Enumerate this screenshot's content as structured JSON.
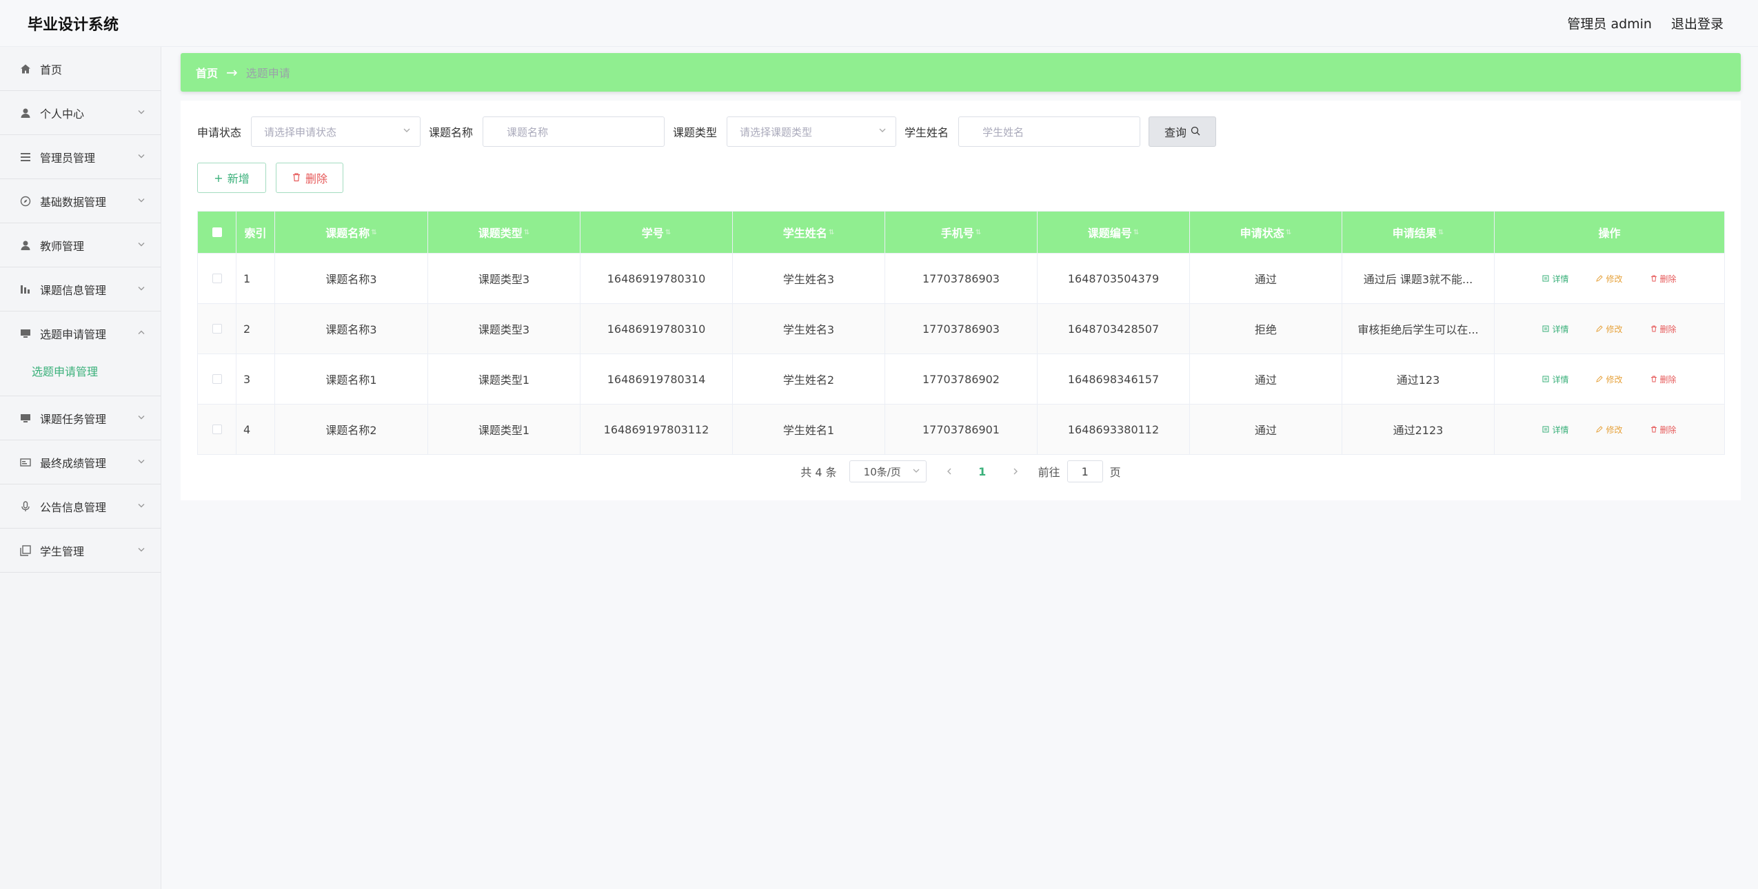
{
  "header": {
    "title": "毕业设计系统",
    "user": "管理员 admin",
    "logout": "退出登录"
  },
  "sidebar": {
    "items": [
      {
        "label": "首页",
        "icon": "home-icon"
      },
      {
        "label": "个人中心",
        "icon": "user-icon"
      },
      {
        "label": "管理员管理",
        "icon": "list-icon"
      },
      {
        "label": "基础数据管理",
        "icon": "compass-icon"
      },
      {
        "label": "教师管理",
        "icon": "user-icon"
      },
      {
        "label": "课题信息管理",
        "icon": "chart-icon"
      },
      {
        "label": "选题申请管理",
        "icon": "monitor-icon"
      },
      {
        "label": "课题任务管理",
        "icon": "monitor-icon"
      },
      {
        "label": "最终成绩管理",
        "icon": "card-icon"
      },
      {
        "label": "公告信息管理",
        "icon": "mic-icon"
      },
      {
        "label": "学生管理",
        "icon": "copy-icon"
      }
    ],
    "submenu": {
      "label": "选题申请管理"
    }
  },
  "breadcrumb": {
    "home": "首页",
    "arrow": "→",
    "current": "选题申请"
  },
  "filters": {
    "status_label": "申请状态",
    "status_placeholder": "请选择申请状态",
    "name_label": "课题名称",
    "name_placeholder": "课题名称",
    "type_label": "课题类型",
    "type_placeholder": "请选择课题类型",
    "student_label": "学生姓名",
    "student_placeholder": "学生姓名",
    "query": "查询"
  },
  "actions": {
    "add": "新增",
    "delete": "删除"
  },
  "table": {
    "headers": {
      "index": "索引",
      "name": "课题名称",
      "type": "课题类型",
      "sno": "学号",
      "student": "学生姓名",
      "phone": "手机号",
      "code": "课题编号",
      "status": "申请状态",
      "result": "申请结果",
      "ops": "操作"
    },
    "ops": {
      "detail": "详情",
      "edit": "修改",
      "delete": "删除"
    },
    "rows": [
      {
        "index": "1",
        "name": "课题名称3",
        "type": "课题类型3",
        "sno": "16486919780310",
        "student": "学生姓名3",
        "phone": "17703786903",
        "code": "1648703504379",
        "status": "通过",
        "result": "通过后 课题3就不能..."
      },
      {
        "index": "2",
        "name": "课题名称3",
        "type": "课题类型3",
        "sno": "16486919780310",
        "student": "学生姓名3",
        "phone": "17703786903",
        "code": "1648703428507",
        "status": "拒绝",
        "result": "审核拒绝后学生可以在..."
      },
      {
        "index": "3",
        "name": "课题名称1",
        "type": "课题类型1",
        "sno": "16486919780314",
        "student": "学生姓名2",
        "phone": "17703786902",
        "code": "1648698346157",
        "status": "通过",
        "result": "通过123"
      },
      {
        "index": "4",
        "name": "课题名称2",
        "type": "课题类型1",
        "sno": "164869197803112",
        "student": "学生姓名1",
        "phone": "17703786901",
        "code": "1648693380112",
        "status": "通过",
        "result": "通过2123"
      }
    ]
  },
  "pagination": {
    "total": "共 4 条",
    "page_size": "10条/页",
    "current": "1",
    "goto_prefix": "前往",
    "goto_value": "1",
    "goto_suffix": "页"
  },
  "colors": {
    "accent": "#90ee90",
    "link": "#3ab07a",
    "danger": "#e65a5a",
    "warning": "#e6a23c"
  }
}
